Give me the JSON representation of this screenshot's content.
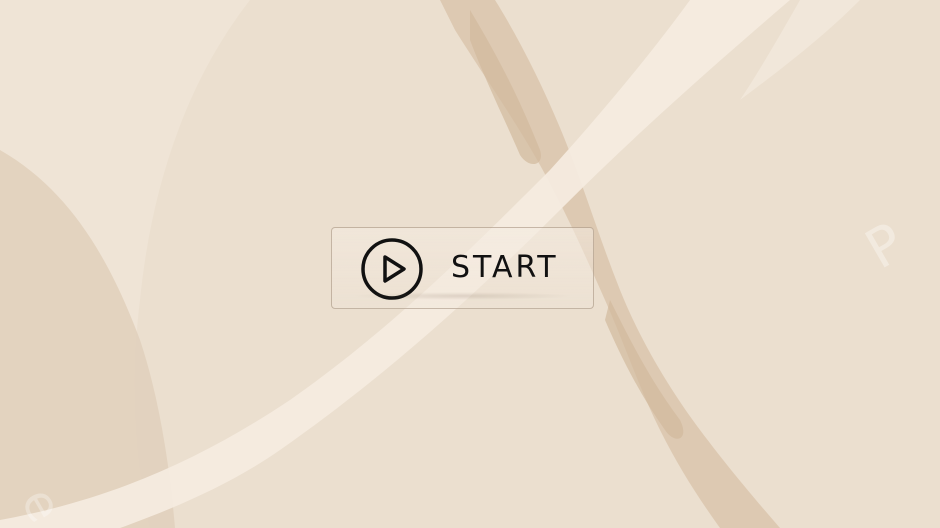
{
  "start_button": {
    "label": "START",
    "icon": "play-circle-icon"
  },
  "colors": {
    "background": "#ebdfcf",
    "stripe": "#f5ebe1",
    "dark_blob": "#d9c3ab",
    "text": "#111111"
  }
}
